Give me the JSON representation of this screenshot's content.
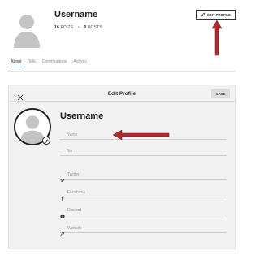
{
  "profile": {
    "username": "Username",
    "edits_count": "16",
    "edits_label": "EDITS",
    "posts_count": "0",
    "posts_label": "POSTS",
    "edit_profile_label": "EDIT PROFILE"
  },
  "tabs": [
    {
      "label": "About",
      "active": true
    },
    {
      "label": "Talk",
      "active": false
    },
    {
      "label": "Contributions",
      "active": false
    },
    {
      "label": "Activity",
      "active": false
    }
  ],
  "modal": {
    "title": "Edit Profile",
    "save_label": "SAVE",
    "username": "Username",
    "fields": {
      "name": {
        "placeholder": "Name",
        "value": ""
      },
      "bio": {
        "placeholder": "Bio",
        "value": ""
      },
      "twitter": {
        "placeholder": "Twitter",
        "value": "",
        "icon": "twitter-icon"
      },
      "facebook": {
        "placeholder": "Facebook",
        "value": "",
        "icon": "facebook-icon"
      },
      "discord": {
        "placeholder": "Discord",
        "value": "",
        "icon": "discord-icon"
      },
      "website": {
        "placeholder": "Website",
        "value": "",
        "icon": "link-icon"
      }
    }
  },
  "colors": {
    "annotation_arrow": "#b02a2a",
    "active_tab_underline": "#2c5e8a",
    "modal_bg": "#f2f2f2",
    "avatar_gray": "#c4c4c4"
  }
}
